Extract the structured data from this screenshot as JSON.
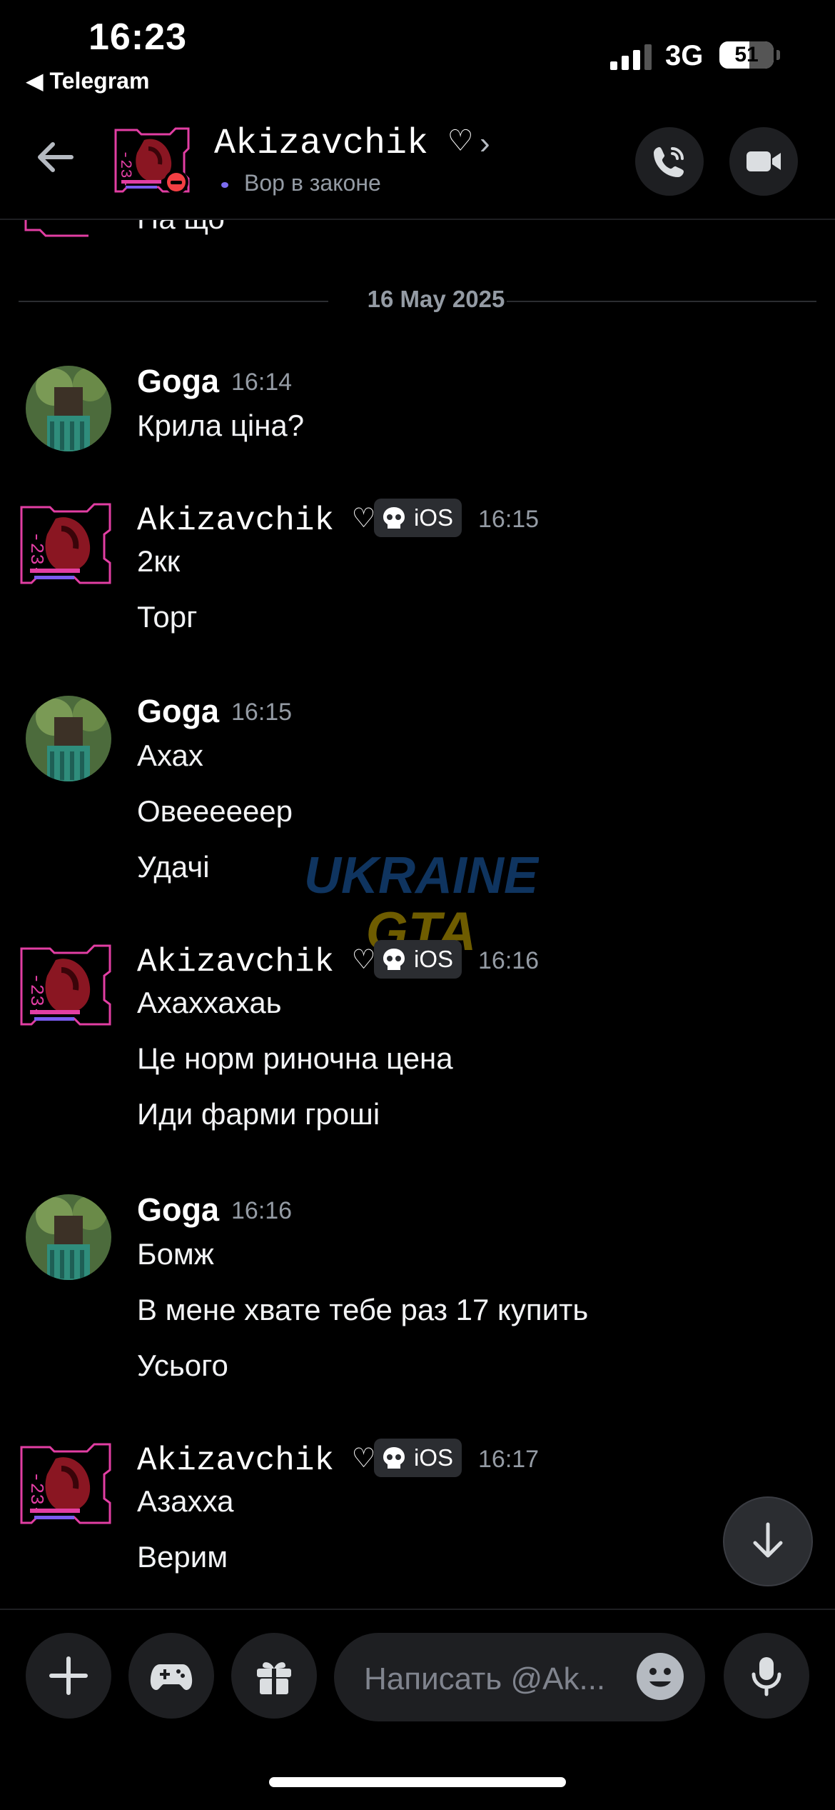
{
  "status_bar": {
    "time": "16:23",
    "back_app": "◀ Telegram",
    "network": "3G",
    "battery": "51"
  },
  "header": {
    "name": "Akizavchik ♡",
    "status": "Вор в законе"
  },
  "partial_message": "На що",
  "date_divider": "16 May 2025",
  "messages": [
    {
      "author": "Goga",
      "time": "16:14",
      "lines": [
        "Крила ціна?"
      ]
    },
    {
      "author": "Akizavchik ♡",
      "tag": "iOS",
      "time": "16:15",
      "lines": [
        "2кк",
        "Торг"
      ]
    },
    {
      "author": "Goga",
      "time": "16:15",
      "lines": [
        "Ахах",
        "Овеееееер",
        "Удачі"
      ]
    },
    {
      "author": "Akizavchik ♡",
      "tag": "iOS",
      "time": "16:16",
      "lines": [
        "Ахаххахаь",
        "Це норм риночна цена",
        "Иди фарми гроші"
      ]
    },
    {
      "author": "Goga",
      "time": "16:16",
      "lines": [
        "Бомж",
        "В мене хвате тебе раз 17 купить",
        "Усього"
      ]
    },
    {
      "author": "Akizavchik ♡",
      "tag": "iOS",
      "time": "16:17",
      "lines": [
        "Азахха",
        "Верим"
      ]
    }
  ],
  "watermark": {
    "line1": "UKRAINE",
    "line2": "GTA"
  },
  "composer": {
    "placeholder": "Написать @Ak..."
  },
  "colors": {
    "accent": "#5865f2",
    "background": "#000000",
    "surface": "#1e1f22",
    "tag_bg": "#2b2d31",
    "muted": "#949ba4",
    "dnd": "#f23f43"
  },
  "icons": [
    "back-arrow-icon",
    "phone-icon",
    "video-camera-icon",
    "skull-icon",
    "arrow-down-icon",
    "plus-icon",
    "gamepad-icon",
    "gift-icon",
    "emoji-icon",
    "microphone-icon"
  ]
}
